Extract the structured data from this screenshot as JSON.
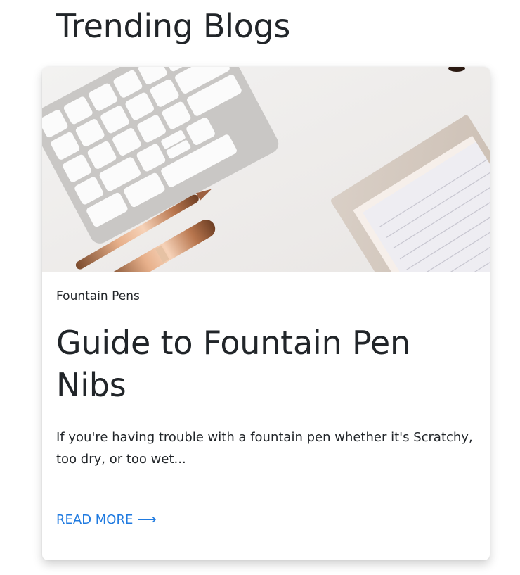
{
  "page": {
    "section_title": "Trending Blogs"
  },
  "card": {
    "image_alt": "Desk with keyboard, rose gold pens and notepad",
    "category": "Fountain Pens",
    "title": "Guide to Fountain Pen Nibs",
    "excerpt": "If you're having trouble with a fountain pen whether it's Scratchy, too dry, or too wet...",
    "read_more_label": "READ MORE",
    "read_more_icon": "arrow-right-icon",
    "link_color": "#1f7ae0"
  }
}
